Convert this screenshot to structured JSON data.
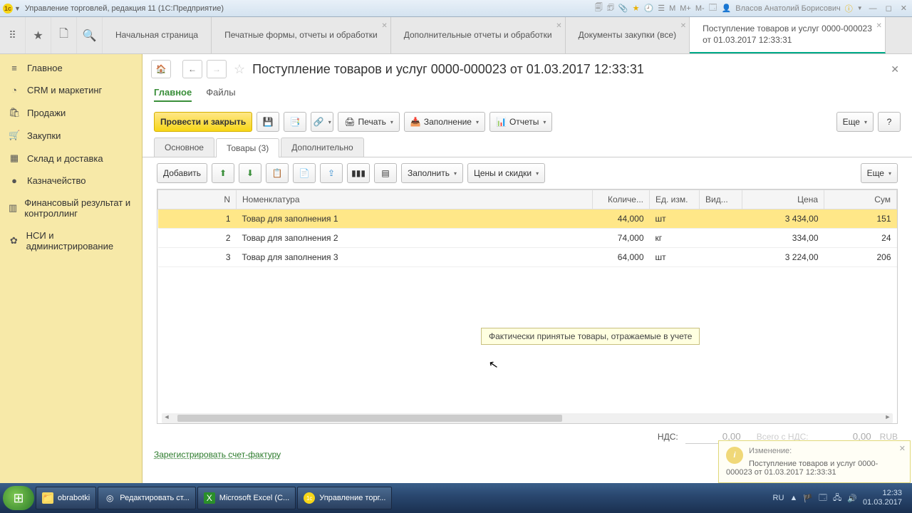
{
  "titlebar": {
    "title": "Управление торговлей, редакция 11  (1С:Предприятие)",
    "m": "M",
    "mplus": "M+",
    "mminus": "M-",
    "user": "Власов Анатолий Борисович"
  },
  "topnav": {
    "tabs": [
      "Начальная страница",
      "Печатные формы, отчеты и обработки",
      "Дополнительные отчеты и обработки",
      "Документы закупки (все)"
    ],
    "active": {
      "l1": "Поступление товаров и услуг 0000-000023",
      "l2": "от 01.03.2017 12:33:31"
    }
  },
  "sidebar": {
    "items": [
      {
        "icon": "≡",
        "label": "Главное"
      },
      {
        "icon": "◔",
        "label": "CRM и маркетинг"
      },
      {
        "icon": "🛍",
        "label": "Продажи"
      },
      {
        "icon": "🛒",
        "label": "Закупки"
      },
      {
        "icon": "▦",
        "label": "Склад и доставка"
      },
      {
        "icon": "●",
        "label": "Казначейство"
      },
      {
        "icon": "▥",
        "label": "Финансовый результат и контроллинг"
      },
      {
        "icon": "✿",
        "label": "НСИ и администрирование"
      }
    ]
  },
  "doc": {
    "title": "Поступление товаров и услуг 0000-000023 от 01.03.2017 12:33:31",
    "subtabs": {
      "main": "Главное",
      "files": "Файлы"
    },
    "toolbar": {
      "post": "Провести и закрыть",
      "print": "Печать",
      "fill": "Заполнение",
      "reports": "Отчеты",
      "more": "Еще"
    },
    "tabs2": {
      "basic": "Основное",
      "goods": "Товары (3)",
      "extra": "Дополнительно"
    },
    "tbtoolbar": {
      "add": "Добавить",
      "fill": "Заполнить",
      "prices": "Цены и скидки",
      "more": "Еще"
    },
    "cols": {
      "n": "N",
      "nom": "Номенклатура",
      "qty": "Количе...",
      "unit": "Ед. изм.",
      "vid": "Вид...",
      "price": "Цена",
      "sum": "Сум"
    },
    "rows": [
      {
        "n": "1",
        "nom": "Товар для заполнения 1",
        "qty": "44,000",
        "unit": "шт",
        "price": "3 434,00",
        "sum": "151"
      },
      {
        "n": "2",
        "nom": "Товар для заполнения 2",
        "qty": "74,000",
        "unit": "кг",
        "price": "334,00",
        "sum": "24"
      },
      {
        "n": "3",
        "nom": "Товар для заполнения 3",
        "qty": "64,000",
        "unit": "шт",
        "price": "3 224,00",
        "sum": "206"
      }
    ],
    "tooltip": "Фактически принятые товары, отражаемые в учете",
    "footer": {
      "nds_lbl": "НДС:",
      "nds_val": "0,00",
      "total_lbl": "Всего с НДС:",
      "total_val": "0,00",
      "cur": "RUB"
    },
    "reglink": "Зарегистрировать счет-фактуру"
  },
  "notif": {
    "title": "Изменение:",
    "body": "Поступление товаров и услуг 0000-000023 от 01.03.2017 12:33:31"
  },
  "taskbar": {
    "items": [
      {
        "icon": "📁",
        "label": "obrabotki",
        "bg": "#f7d860"
      },
      {
        "icon": "◎",
        "label": "Редактировать ст...",
        "bg": "#e55"
      },
      {
        "icon": "X",
        "label": "Microsoft Excel (C...",
        "bg": "#2a8f2a"
      },
      {
        "icon": "1c",
        "label": "Управление торг...",
        "bg": "#f7d617"
      }
    ],
    "lang": "RU",
    "time": "12:33",
    "date": "01.03.2017"
  }
}
